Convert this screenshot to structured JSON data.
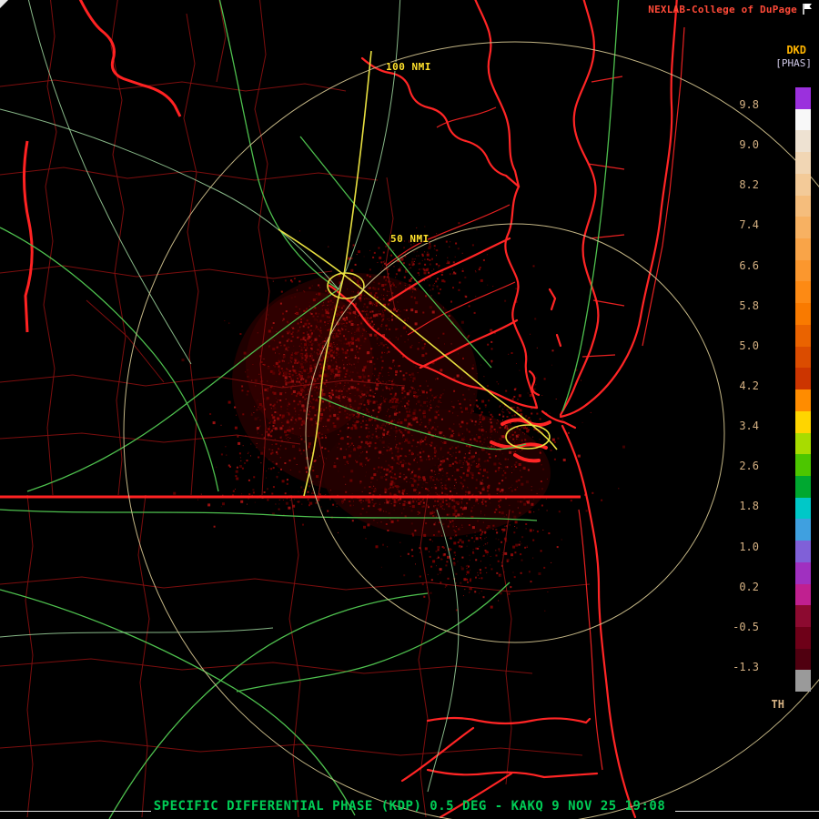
{
  "brand": {
    "text": "NEXLAB-College of DuPage"
  },
  "colorbar": {
    "product": "DKD",
    "units": "[PHAS]",
    "footer": "TH",
    "ticks": [
      "9.8",
      "9.0",
      "8.2",
      "7.4",
      "6.6",
      "5.8",
      "5.0",
      "4.2",
      "3.4",
      "2.6",
      "1.8",
      "1.0",
      "0.2",
      "-0.5",
      "-1.3"
    ],
    "colors": [
      "#9b30dd",
      "#f8f8f8",
      "#eee2d2",
      "#f1d6b4",
      "#f3ca98",
      "#f5bd7c",
      "#f7b162",
      "#f9a448",
      "#fb972e",
      "#fd8a14",
      "#f97a00",
      "#ea6300",
      "#db4c00",
      "#cc3500",
      "#ff8c00",
      "#ffd500",
      "#a8dc00",
      "#4cc600",
      "#00a830",
      "#00c8c8",
      "#3fa0e0",
      "#8060d8",
      "#a030c0",
      "#c02090",
      "#8c0a30",
      "#6e0018",
      "#500010",
      "#9a9a9a"
    ]
  },
  "rings": {
    "outer_label": "100 NMI",
    "inner_label": "50 NMI"
  },
  "status_bar": {
    "text": "SPECIFIC DIFFERENTIAL PHASE (KDP) 0.5 DEG - KAKQ 9 NOV 25 19:08"
  },
  "palette": {
    "brand": "#ff4a38",
    "product": "#ffb400",
    "units": "#cfc8e6",
    "tick": "#d5b183",
    "footerGreen": "#00cc55",
    "labelYellow": "#ffe12c",
    "county": "#8a0f0f",
    "border": "#ff2222",
    "coast": "#ff2525",
    "hwyGreen": "#4ec04e",
    "hwyLight": "#a0d8a0",
    "hwyYellow": "#e8e040",
    "ring": "#cfc08c"
  },
  "map_style": {
    "echo_colors": [
      "#3f0000",
      "#520000",
      "#660000",
      "#770404",
      "#880808",
      "#991111",
      "#6e0000"
    ]
  }
}
